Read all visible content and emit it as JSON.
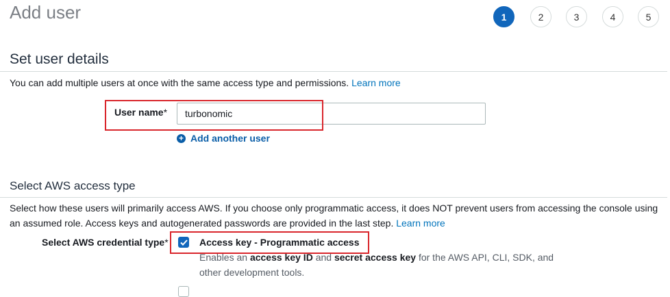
{
  "header": {
    "title": "Add user",
    "steps": [
      "1",
      "2",
      "3",
      "4",
      "5"
    ],
    "active_step": "1"
  },
  "details": {
    "title": "Set user details",
    "desc": "You can add multiple users at once with the same access type and permissions.",
    "learn_more": "Learn more",
    "user_name_label": "User name",
    "required_mark": "*",
    "user_name_value": "turbonomic",
    "add_another_user": "Add another user"
  },
  "access": {
    "title": "Select AWS access type",
    "desc_line1": "Select how these users will primarily access AWS. If you choose only programmatic access, it does NOT prevent users from accessing the console using",
    "desc_line2": "an assumed role. Access keys and autogenerated passwords are provided in the last step.",
    "learn_more": "Learn more",
    "credential_label": "Select AWS credential type",
    "required_mark": "*",
    "option1": {
      "title": "Access key - Programmatic access",
      "desc_part1": "Enables an ",
      "desc_bold1": "access key ID",
      "desc_part2": " and ",
      "desc_bold2": "secret access key",
      "desc_part3": " for the AWS API, CLI, SDK, and",
      "desc_line2": "other development tools.",
      "checked": true
    }
  },
  "colors": {
    "accent": "#1166bb",
    "link": "#0073bb",
    "highlight": "#d9252b"
  }
}
